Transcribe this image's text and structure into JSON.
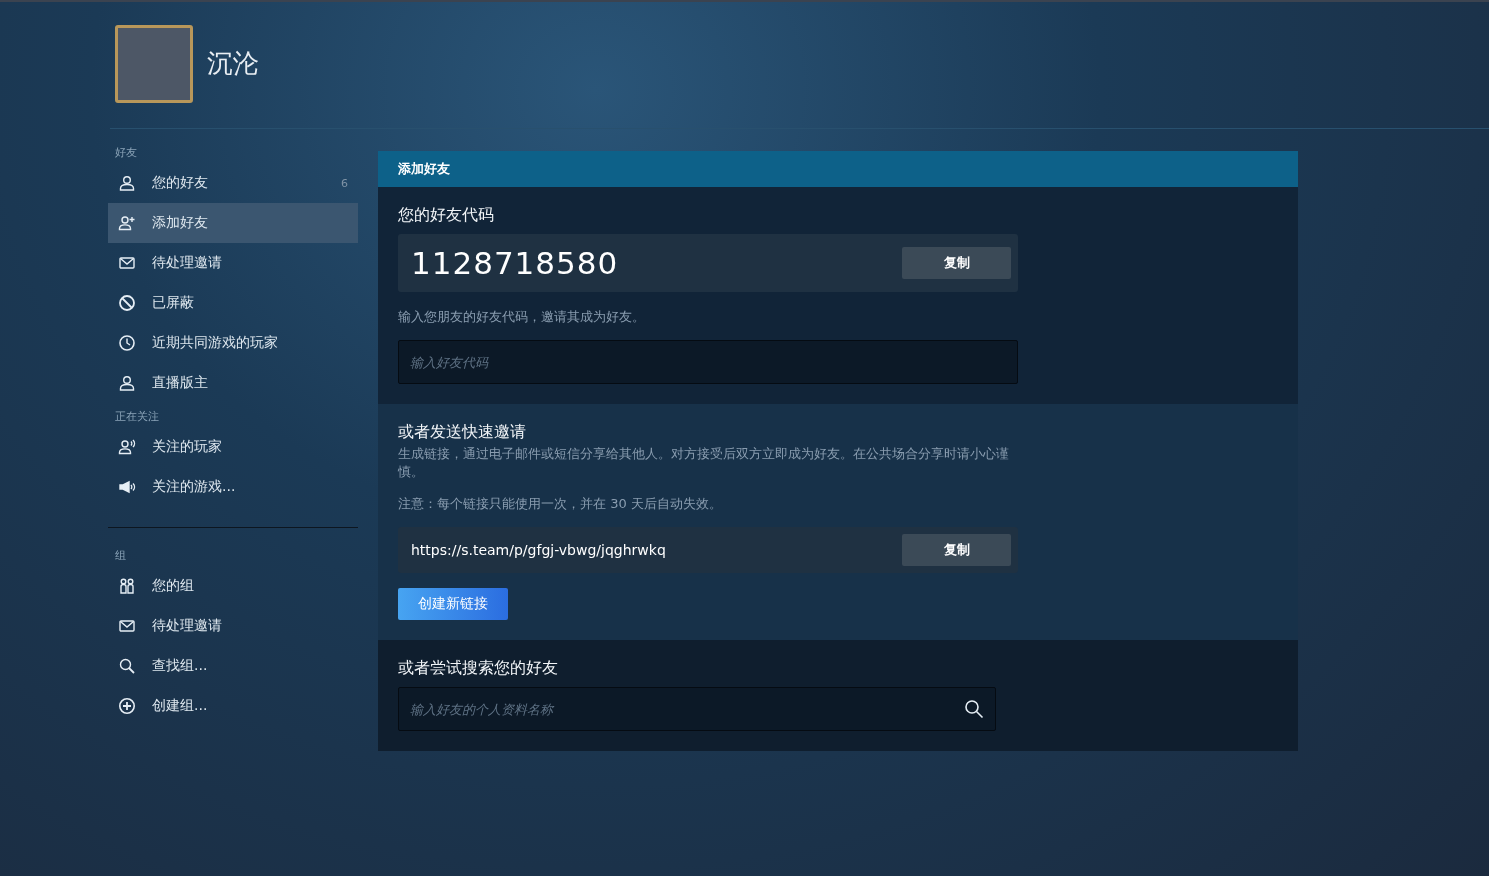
{
  "profile": {
    "name": "沉沦"
  },
  "sidebar": {
    "groups": [
      {
        "heading": "好友",
        "items": [
          {
            "label": "您的好友",
            "kind": "person",
            "count": "6",
            "selected": false
          },
          {
            "label": "添加好友",
            "kind": "person-plus",
            "selected": true
          },
          {
            "label": "待处理邀请",
            "kind": "envelope",
            "selected": false
          },
          {
            "label": "已屏蔽",
            "kind": "ban",
            "selected": false
          },
          {
            "label": "近期共同游戏的玩家",
            "kind": "clock",
            "selected": false
          },
          {
            "label": "直播版主",
            "kind": "person",
            "selected": false
          }
        ]
      },
      {
        "heading": "正在关注",
        "items": [
          {
            "label": "关注的玩家",
            "kind": "person-wave",
            "selected": false
          },
          {
            "label": "关注的游戏...",
            "kind": "megaphone",
            "selected": false
          }
        ]
      },
      {
        "heading": "组",
        "divider": true,
        "items": [
          {
            "label": "您的组",
            "kind": "group",
            "selected": false
          },
          {
            "label": "待处理邀请",
            "kind": "envelope",
            "selected": false
          },
          {
            "label": "查找组...",
            "kind": "search",
            "selected": false
          },
          {
            "label": "创建组...",
            "kind": "plus",
            "selected": false
          }
        ]
      }
    ]
  },
  "panel": {
    "title": "添加好友",
    "friend_code": {
      "heading": "您的好友代码",
      "code": "1128718580",
      "copy_button": "复制",
      "hint": "输入您朋友的好友代码，邀请其成为好友。",
      "placeholder": "输入好友代码"
    },
    "quick_invite": {
      "heading": "或者发送快速邀请",
      "description": "生成链接，通过电子邮件或短信分享给其他人。对方接受后双方立即成为好友。在公共场合分享时请小心谨慎。",
      "note": "注意：每个链接只能使用一次，并在 30 天后自动失效。",
      "link": "https://s.team/p/gfgj-vbwg/jqghrwkq",
      "copy_button": "复制",
      "create_button": "创建新链接"
    },
    "search": {
      "heading": "或者尝试搜索您的好友",
      "placeholder": "输入好友的个人资料名称"
    }
  }
}
